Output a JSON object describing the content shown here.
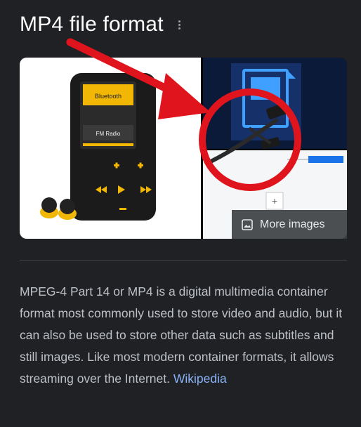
{
  "title": "MP4 file format",
  "more_images_label": "More images",
  "description": "MPEG-4 Part 14 or MP4 is a digital multimedia container format most commonly used to store video and audio, but it can also be used to store other data such as subtitles and still images. Like most modern container formats, it allows streaming over the Internet.",
  "source_link": "Wikipedia",
  "player_screen": {
    "top_text": "Bluetooth",
    "mid_text": "FM Radio"
  },
  "colors": {
    "background": "#202124",
    "link": "#8ab4f8",
    "annotation": "#e0141c",
    "player_accent": "#f2b705"
  },
  "icons": [
    "more-vert-icon",
    "image-icon"
  ]
}
